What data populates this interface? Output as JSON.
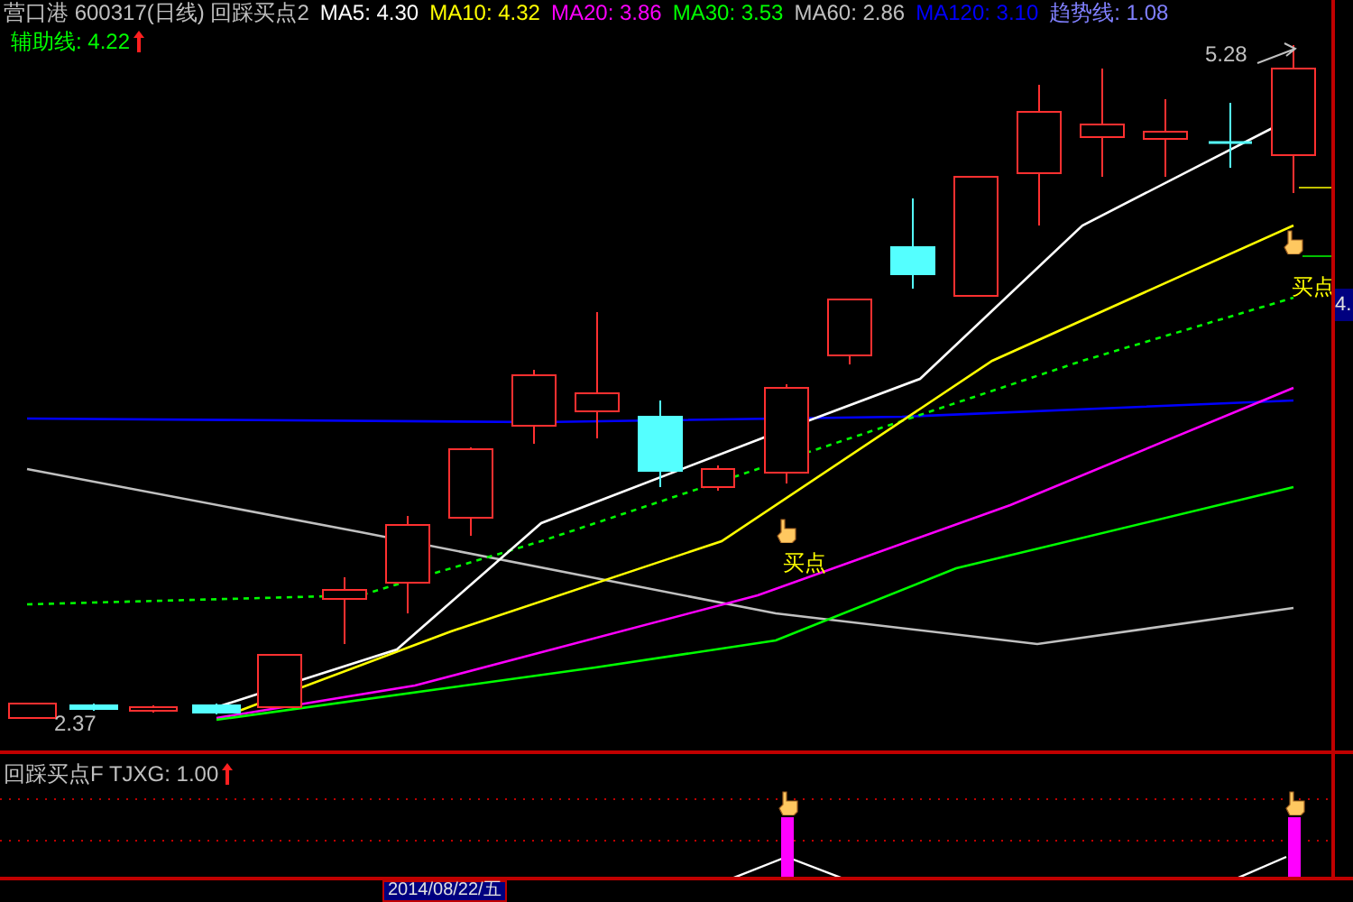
{
  "header": {
    "title": "营口港 600317(日线) 回踩买点2",
    "indicators": [
      {
        "label": "MA5: 4.30",
        "color": "#ffffff"
      },
      {
        "label": "MA10: 4.32",
        "color": "#ffff00"
      },
      {
        "label": "MA20: 3.86",
        "color": "#ff00ff"
      },
      {
        "label": "MA30: 3.53",
        "color": "#00ff00"
      },
      {
        "label": "MA60: 2.86",
        "color": "#c0c0c0"
      },
      {
        "label": "MA120: 3.10",
        "color": "#0000ff"
      },
      {
        "label": "趋势线: 1.08",
        "color": "#8080ff"
      }
    ]
  },
  "aux_line": {
    "label": "辅助线: 4.22"
  },
  "annotations": [
    {
      "kind": "high",
      "text": "5.28"
    },
    {
      "kind": "low",
      "text": "2.37"
    }
  ],
  "buy_labels": [
    "买点",
    "买点"
  ],
  "indicator_panel": {
    "label": "回踩买点F TJXG: 1.00"
  },
  "axis": {
    "price_tag": "4.",
    "date_tag": "2014/08/22/五"
  }
}
